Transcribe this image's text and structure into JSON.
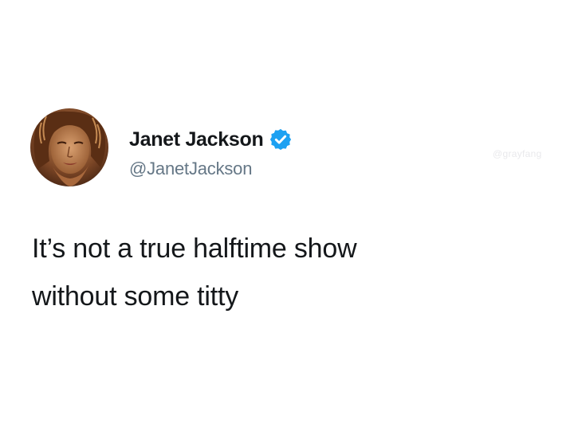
{
  "author": {
    "display_name": "Janet Jackson",
    "handle": "@JanetJackson",
    "verified": true,
    "avatar_icon": "profile-photo"
  },
  "tweet": {
    "lines": [
      "It’s not a true halftime show",
      "without some titty"
    ]
  },
  "watermark": "@grayfang",
  "colors": {
    "background": "#ffffff",
    "text": "#14171a",
    "handle": "#657786",
    "verified_badge": "#1da1f2"
  }
}
